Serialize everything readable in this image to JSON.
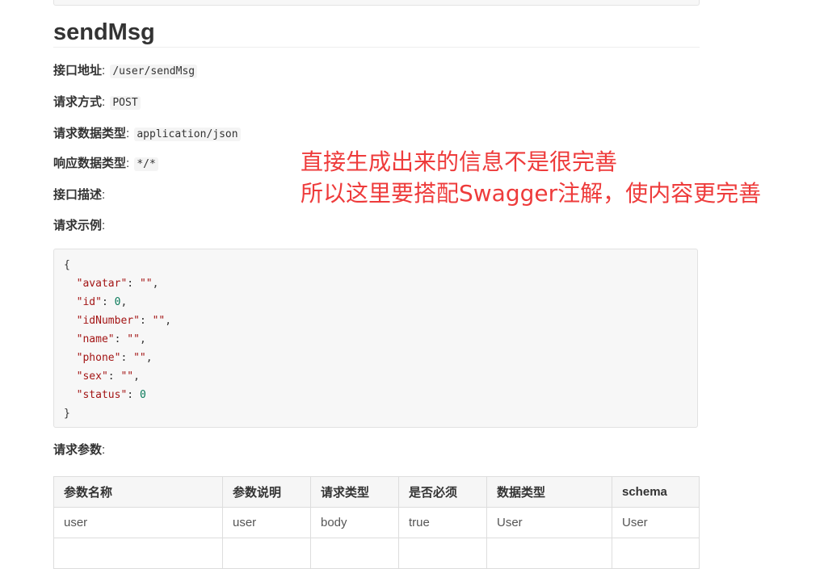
{
  "endpoint": {
    "title": "sendMsg",
    "address_label": "接口地址",
    "address_value": "/user/sendMsg",
    "method_label": "请求方式",
    "method_value": "POST",
    "req_type_label": "请求数据类型",
    "req_type_value": "application/json",
    "resp_type_label": "响应数据类型",
    "resp_type_value": "*/*",
    "desc_label": "接口描述",
    "example_label": "请求示例",
    "params_label": "请求参数"
  },
  "annotation": {
    "line1": "直接生成出来的信息不是很完善",
    "line2": "所以这里要搭配Swagger注解，使内容更完善",
    "color": "#ee3b3b"
  },
  "example": {
    "open": "{",
    "close": "}",
    "fields": [
      {
        "key": "\"avatar\"",
        "value": "\"\"",
        "kind": "str",
        "sep": ","
      },
      {
        "key": "\"id\"",
        "value": "0",
        "kind": "num",
        "sep": ","
      },
      {
        "key": "\"idNumber\"",
        "value": "\"\"",
        "kind": "str",
        "sep": ","
      },
      {
        "key": "\"name\"",
        "value": "\"\"",
        "kind": "str",
        "sep": ","
      },
      {
        "key": "\"phone\"",
        "value": "\"\"",
        "kind": "str",
        "sep": ","
      },
      {
        "key": "\"sex\"",
        "value": "\"\"",
        "kind": "str",
        "sep": ","
      },
      {
        "key": "\"status\"",
        "value": "0",
        "kind": "num",
        "sep": ""
      }
    ]
  },
  "params_table": {
    "headers": [
      "参数名称",
      "参数说明",
      "请求类型",
      "是否必须",
      "数据类型",
      "schema"
    ],
    "rows": [
      [
        "user",
        "user",
        "body",
        "true",
        "User",
        "User"
      ]
    ]
  }
}
